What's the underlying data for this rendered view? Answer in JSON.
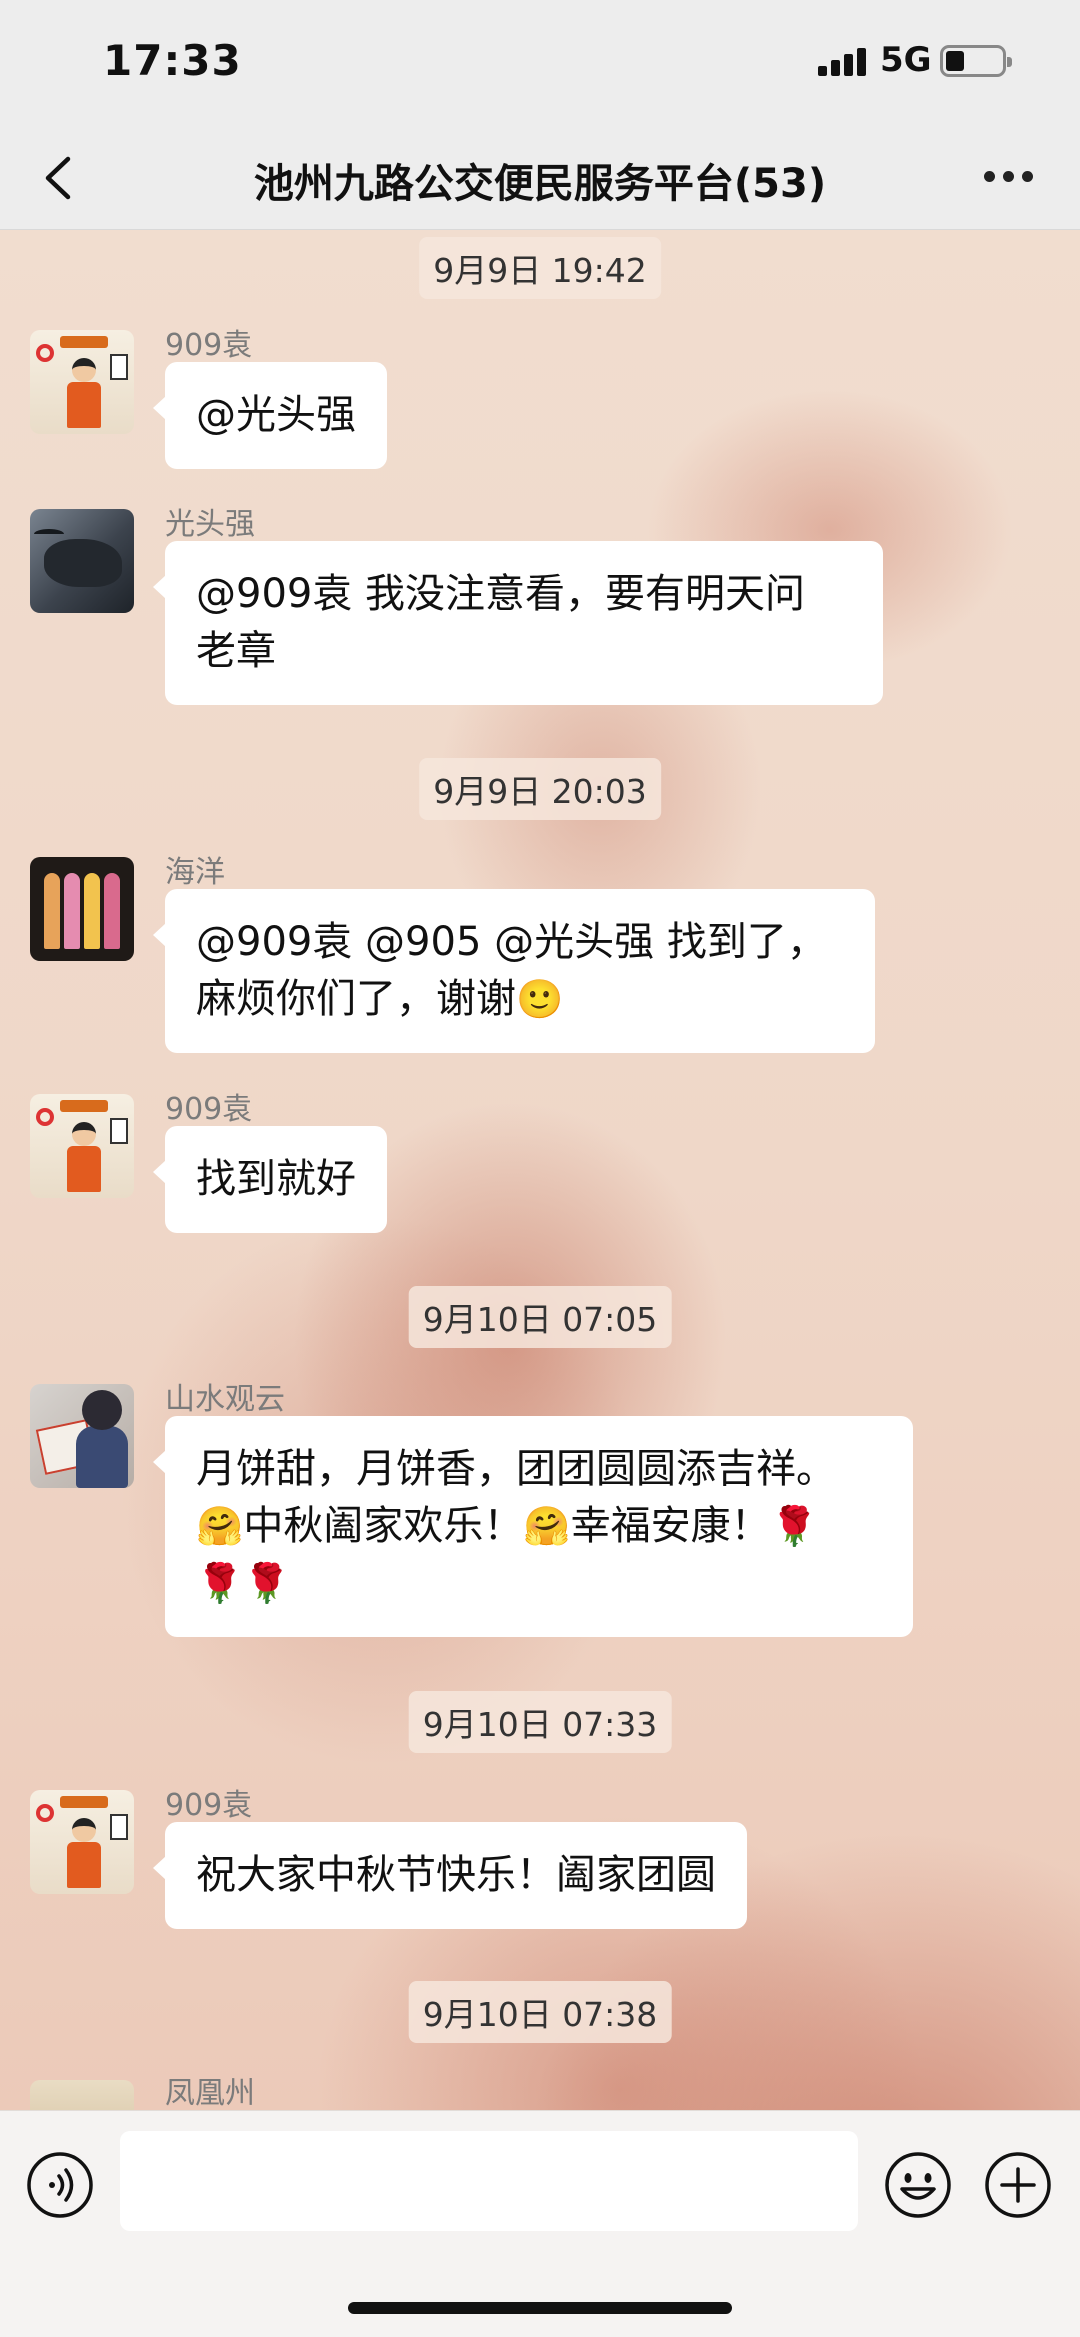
{
  "status_bar": {
    "time": "17:33",
    "network": "5G"
  },
  "header": {
    "title": "池州九路公交便民服务平台(53)"
  },
  "messages": {
    "ts1": "9月9日 19:42",
    "m1": {
      "sender": "909袁",
      "text": "@光头强"
    },
    "m2": {
      "sender": "光头强",
      "line1": "@909袁 我没注意看，要有明天问",
      "line2": "老章"
    },
    "ts2": "9月9日 20:03",
    "m3": {
      "sender": "海洋",
      "line1": "@909袁 @905 @光头强 找到了，",
      "line2": "麻烦你们了，谢谢",
      "emoji": "🙂"
    },
    "m4": {
      "sender": "909袁",
      "text": "找到就好"
    },
    "ts3": "9月10日 07:05",
    "m5": {
      "sender": "山水观云",
      "line1": "月饼甜，月饼香，团团圆圆添吉祥。",
      "e1": "🤗",
      "t1": "中秋阖家欢乐！",
      "e2": "🤗",
      "t2": "幸福安康！",
      "e3": "🌹",
      "e4": "🌹",
      "e5": "🌹"
    },
    "ts4": "9月10日 07:33",
    "m6": {
      "sender": "909袁",
      "text": "祝大家中秋节快乐！阖家团圆"
    },
    "ts5": "9月10日 07:38",
    "m7": {
      "sender": "凤凰州"
    }
  },
  "input": {
    "placeholder": ""
  }
}
